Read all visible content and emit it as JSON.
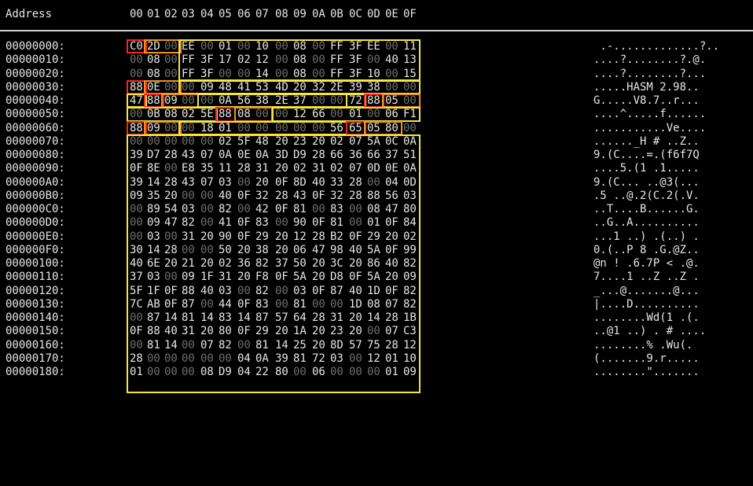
{
  "header": {
    "address_label": "Address",
    "columns": [
      "00",
      "01",
      "02",
      "03",
      "04",
      "05",
      "06",
      "07",
      "08",
      "09",
      "0A",
      "0B",
      "0C",
      "0D",
      "0E",
      "0F"
    ]
  },
  "colors": {
    "zero_byte": "#6e6e6e",
    "field_yellow": "#f4e63c",
    "field_orange": "#f0921e",
    "field_red": "#ff2020"
  },
  "rows": [
    {
      "addr": "00000000:",
      "bytes": [
        "C0",
        "2D",
        "00",
        "EE",
        "00",
        "01",
        "00",
        "10",
        "00",
        "08",
        "00",
        "FF",
        "3F",
        "EE",
        "00",
        "11"
      ],
      "ascii": " .-.............?.."
    },
    {
      "addr": "00000010:",
      "bytes": [
        "00",
        "08",
        "00",
        "FF",
        "3F",
        "17",
        "02",
        "12",
        "00",
        "08",
        "00",
        "FF",
        "3F",
        "00",
        "40",
        "13"
      ],
      "ascii": "....?........?.@."
    },
    {
      "addr": "00000020:",
      "bytes": [
        "00",
        "08",
        "00",
        "FF",
        "3F",
        "00",
        "00",
        "14",
        "00",
        "08",
        "00",
        "FF",
        "3F",
        "10",
        "00",
        "15"
      ],
      "ascii": "....?........?..."
    },
    {
      "addr": "00000030:",
      "bytes": [
        "88",
        "0E",
        "00",
        "00",
        "09",
        "48",
        "41",
        "53",
        "4D",
        "20",
        "32",
        "2E",
        "39",
        "38",
        "00",
        "00"
      ],
      "ascii": ".....HASM 2.98.."
    },
    {
      "addr": "00000040:",
      "bytes": [
        "47",
        "88",
        "09",
        "00",
        "00",
        "0A",
        "56",
        "38",
        "2E",
        "37",
        "00",
        "00",
        "72",
        "88",
        "05",
        "00"
      ],
      "ascii": "G.....V8.7..r..."
    },
    {
      "addr": "00000050:",
      "bytes": [
        "00",
        "0B",
        "08",
        "02",
        "5E",
        "88",
        "08",
        "00",
        "00",
        "12",
        "66",
        "00",
        "01",
        "00",
        "06",
        "F1"
      ],
      "ascii": "....^.....f......"
    },
    {
      "addr": "00000060:",
      "bytes": [
        "88",
        "09",
        "00",
        "00",
        "18",
        "01",
        "00",
        "00",
        "00",
        "00",
        "00",
        "56",
        "65",
        "05",
        "80",
        "00"
      ],
      "ascii": "...........Ve...."
    },
    {
      "addr": "00000070:",
      "bytes": [
        "00",
        "00",
        "00",
        "00",
        "00",
        "02",
        "5F",
        "48",
        "20",
        "23",
        "20",
        "02",
        "07",
        "5A",
        "0C",
        "0A"
      ],
      "ascii": "......_H # ..Z.."
    },
    {
      "addr": "00000080:",
      "bytes": [
        "39",
        "D7",
        "28",
        "43",
        "07",
        "0A",
        "0E",
        "0A",
        "3D",
        "D9",
        "28",
        "66",
        "36",
        "66",
        "37",
        "51"
      ],
      "ascii": "9.(C....=.(f6f7Q"
    },
    {
      "addr": "00000090:",
      "bytes": [
        "0F",
        "8E",
        "00",
        "E8",
        "35",
        "11",
        "28",
        "31",
        "20",
        "02",
        "31",
        "02",
        "07",
        "0D",
        "0E",
        "0A"
      ],
      "ascii": "....5.(1 .1....."
    },
    {
      "addr": "000000A0:",
      "bytes": [
        "39",
        "14",
        "28",
        "43",
        "07",
        "03",
        "00",
        "20",
        "0F",
        "8D",
        "40",
        "33",
        "28",
        "00",
        "04",
        "0D"
      ],
      "ascii": "9.(C... ..@3(..."
    },
    {
      "addr": "000000B0:",
      "bytes": [
        "09",
        "35",
        "20",
        "00",
        "00",
        "40",
        "0F",
        "32",
        "28",
        "43",
        "0F",
        "32",
        "28",
        "88",
        "56",
        "03"
      ],
      "ascii": ".5 ..@.2(C.2(.V."
    },
    {
      "addr": "000000C0:",
      "bytes": [
        "00",
        "89",
        "54",
        "03",
        "00",
        "82",
        "00",
        "42",
        "0F",
        "81",
        "00",
        "83",
        "00",
        "08",
        "47",
        "80"
      ],
      "ascii": "..T....B......G."
    },
    {
      "addr": "000000D0:",
      "bytes": [
        "00",
        "09",
        "47",
        "82",
        "00",
        "41",
        "0F",
        "83",
        "00",
        "90",
        "0F",
        "81",
        "00",
        "01",
        "0F",
        "84"
      ],
      "ascii": "..G..A.........."
    },
    {
      "addr": "000000E0:",
      "bytes": [
        "00",
        "03",
        "00",
        "31",
        "20",
        "90",
        "0F",
        "29",
        "20",
        "12",
        "28",
        "B2",
        "0F",
        "29",
        "20",
        "02"
      ],
      "ascii": "...1 ..) .(..) ."
    },
    {
      "addr": "000000F0:",
      "bytes": [
        "30",
        "14",
        "28",
        "00",
        "00",
        "50",
        "20",
        "38",
        "20",
        "06",
        "47",
        "98",
        "40",
        "5A",
        "0F",
        "99"
      ],
      "ascii": "0.(..P 8 .G.@Z.."
    },
    {
      "addr": "00000100:",
      "bytes": [
        "40",
        "6E",
        "20",
        "21",
        "20",
        "02",
        "36",
        "82",
        "37",
        "50",
        "20",
        "3C",
        "20",
        "86",
        "40",
        "82"
      ],
      "ascii": "@n ! .6.7P < .@."
    },
    {
      "addr": "00000110:",
      "bytes": [
        "37",
        "03",
        "00",
        "09",
        "1F",
        "31",
        "20",
        "F8",
        "0F",
        "5A",
        "20",
        "D8",
        "0F",
        "5A",
        "20",
        "09"
      ],
      "ascii": "7....1 ..Z ..Z ."
    },
    {
      "addr": "00000120:",
      "bytes": [
        "5F",
        "1F",
        "0F",
        "88",
        "40",
        "03",
        "00",
        "82",
        "00",
        "03",
        "0F",
        "87",
        "40",
        "1D",
        "0F",
        "82"
      ],
      "ascii": "_...@.......@..."
    },
    {
      "addr": "00000130:",
      "bytes": [
        "7C",
        "AB",
        "0F",
        "87",
        "00",
        "44",
        "0F",
        "83",
        "00",
        "81",
        "00",
        "00",
        "1D",
        "08",
        "07",
        "82"
      ],
      "ascii": "|....D.........."
    },
    {
      "addr": "00000140:",
      "bytes": [
        "00",
        "87",
        "14",
        "81",
        "14",
        "83",
        "14",
        "87",
        "57",
        "64",
        "28",
        "31",
        "20",
        "14",
        "28",
        "1B"
      ],
      "ascii": "........Wd(1 .(."
    },
    {
      "addr": "00000150:",
      "bytes": [
        "0F",
        "88",
        "40",
        "31",
        "20",
        "80",
        "0F",
        "29",
        "20",
        "1A",
        "20",
        "23",
        "20",
        "00",
        "07",
        "C3"
      ],
      "ascii": "..@1 ..) . # ...."
    },
    {
      "addr": "00000160:",
      "bytes": [
        "00",
        "81",
        "14",
        "00",
        "07",
        "82",
        "00",
        "81",
        "14",
        "25",
        "20",
        "8D",
        "57",
        "75",
        "28",
        "12"
      ],
      "ascii": "........% .Wu(."
    },
    {
      "addr": "00000170:",
      "bytes": [
        "28",
        "00",
        "00",
        "00",
        "00",
        "00",
        "04",
        "0A",
        "39",
        "81",
        "72",
        "03",
        "00",
        "12",
        "01",
        "10"
      ],
      "ascii": "(.......9.r....."
    },
    {
      "addr": "00000180:",
      "bytes": [
        "01",
        "00",
        "00",
        "00",
        "08",
        "D9",
        "04",
        "22",
        "80",
        "00",
        "06",
        "00",
        "00",
        "00",
        "01",
        "09"
      ],
      "ascii": "........\"......."
    }
  ]
}
